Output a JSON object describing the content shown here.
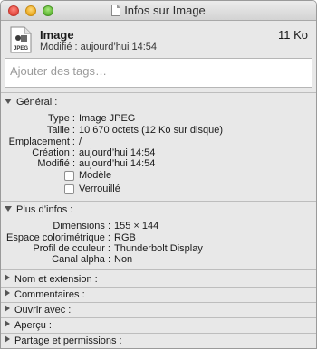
{
  "window": {
    "title": "Infos sur Image"
  },
  "header": {
    "file_icon": "jpeg-file-icon",
    "file_icon_label": "JPEG",
    "name": "Image",
    "modified": "Modifié : aujourd’hui 14:54",
    "size": "11 Ko"
  },
  "tags": {
    "placeholder": "Ajouter des tags…"
  },
  "general": {
    "heading": "Général :",
    "rows": [
      {
        "key": "Type :",
        "value": "Image JPEG"
      },
      {
        "key": "Taille :",
        "value": "10 670 octets (12 Ko sur disque)"
      },
      {
        "key": "Emplacement :",
        "value": "/"
      },
      {
        "key": "Création :",
        "value": "aujourd’hui 14:54"
      },
      {
        "key": "Modifié :",
        "value": "aujourd’hui 14:54"
      }
    ],
    "checkboxes": [
      {
        "label": "Modèle",
        "checked": false
      },
      {
        "label": "Verrouillé",
        "checked": false
      }
    ]
  },
  "more_info": {
    "heading": "Plus d’infos :",
    "rows": [
      {
        "key": "Dimensions :",
        "value": "155 × 144"
      },
      {
        "key": "Espace colorimétrique :",
        "value": "RGB"
      },
      {
        "key": "Profil de couleur :",
        "value": "Thunderbolt Display"
      },
      {
        "key": "Canal alpha :",
        "value": "Non"
      }
    ]
  },
  "collapsed_sections": [
    {
      "label": "Nom et extension :"
    },
    {
      "label": "Commentaires :"
    },
    {
      "label": "Ouvrir avec :"
    },
    {
      "label": "Aperçu :"
    },
    {
      "label": "Partage et permissions :"
    }
  ]
}
